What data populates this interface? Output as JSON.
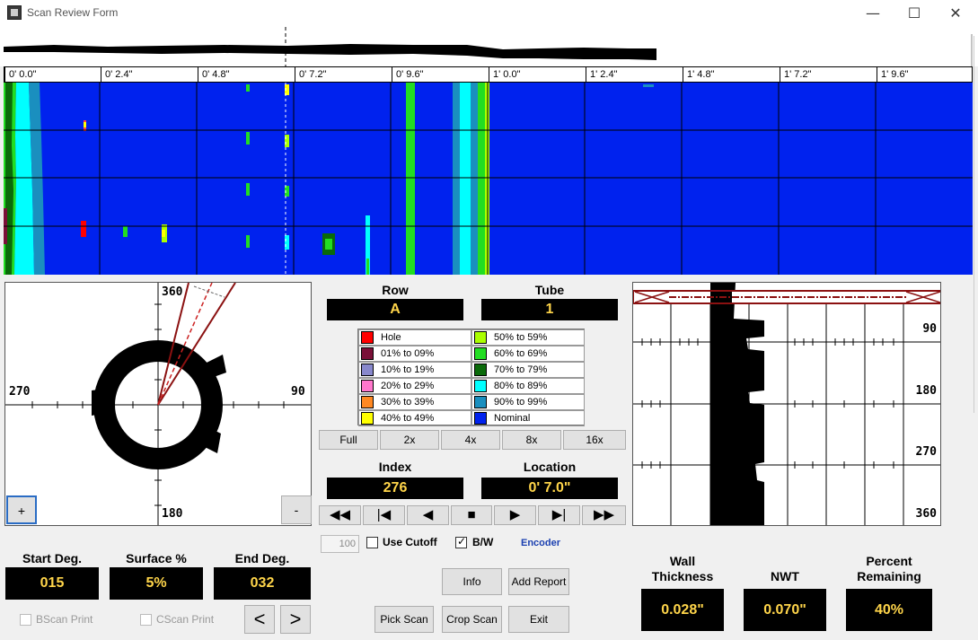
{
  "window": {
    "title": "Scan Review Form",
    "minimize_glyph": "—",
    "maximize_glyph": "☐",
    "close_glyph": "✕"
  },
  "ruler": {
    "labels": [
      "0' 0.0\"",
      "0' 2.4\"",
      "0' 4.8\"",
      "0' 7.2\"",
      "0' 9.6\"",
      "1' 0.0\"",
      "1' 2.4\"",
      "1' 4.8\"",
      "1' 7.2\"",
      "1' 9.6\""
    ]
  },
  "polar": {
    "top_label": "360",
    "left_label": "270",
    "right_label": "90",
    "bottom_label": "180",
    "zoom_in": "+",
    "zoom_out": "-"
  },
  "row": {
    "label": "Row",
    "value": "A"
  },
  "tube": {
    "label": "Tube",
    "value": "1"
  },
  "legend": [
    {
      "label": "Hole",
      "color": "#ff0000"
    },
    {
      "label": "50% to 59%",
      "color": "#aaff00"
    },
    {
      "label": "01% to 09%",
      "color": "#7a1038"
    },
    {
      "label": "60% to 69%",
      "color": "#22dd22"
    },
    {
      "label": "10% to 19%",
      "color": "#8888cc"
    },
    {
      "label": "70% to 79%",
      "color": "#0a6a0a"
    },
    {
      "label": "20% to 29%",
      "color": "#ff77cc"
    },
    {
      "label": "80% to 89%",
      "color": "#00ffff"
    },
    {
      "label": "30% to 39%",
      "color": "#ff8822"
    },
    {
      "label": "90% to 99%",
      "color": "#1a8fbf"
    },
    {
      "label": "40% to 49%",
      "color": "#ffff00"
    },
    {
      "label": "Nominal",
      "color": "#0022ee"
    }
  ],
  "zoom": [
    "Full",
    "2x",
    "4x",
    "8x",
    "16x"
  ],
  "index": {
    "label": "Index",
    "value": "276"
  },
  "location": {
    "label": "Location",
    "value": "0' 7.0\""
  },
  "nav": [
    "◀◀",
    "|◀",
    "◀",
    "■",
    "▶",
    "▶|",
    "▶▶"
  ],
  "cutoff": {
    "value": "100",
    "label": "Use Cutoff"
  },
  "bw": {
    "label": "B/W"
  },
  "encoder": "Encoder",
  "start_deg": {
    "label": "Start Deg.",
    "value": "015"
  },
  "surface": {
    "label": "Surface %",
    "value": "5%"
  },
  "end_deg": {
    "label": "End Deg.",
    "value": "032"
  },
  "bscan_print": "BScan Print",
  "cscan_print": "CScan Print",
  "prev": "<",
  "next": ">",
  "buttons": {
    "info": "Info",
    "add_report": "Add Report",
    "pick_scan": "Pick Scan",
    "crop_scan": "Crop Scan",
    "exit": "Exit"
  },
  "wall": {
    "label_line1": "Wall",
    "label_line2": "Thickness",
    "value": "0.028\""
  },
  "nwt": {
    "label": "NWT",
    "value": "0.070\""
  },
  "percent": {
    "label_line1": "Percent",
    "label_line2": "Remaining",
    "value": "40%"
  },
  "ascan": {
    "labels": [
      "90",
      "180",
      "270",
      "360"
    ]
  },
  "colors": {
    "nominal": "#0022ee",
    "value_text": "#ffd54a",
    "encoder": "#1a3fb0"
  }
}
